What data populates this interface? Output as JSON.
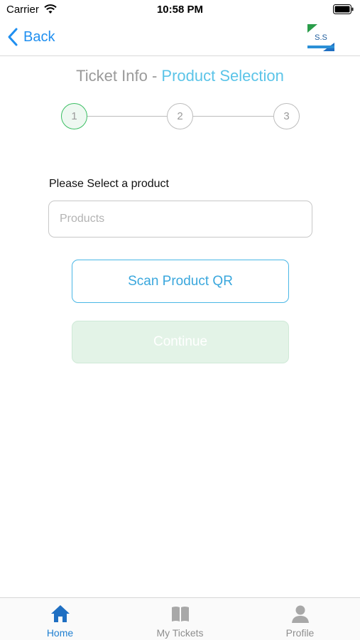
{
  "status_bar": {
    "carrier": "Carrier",
    "time": "10:58 PM"
  },
  "nav": {
    "back_label": "Back",
    "logo_text": "S.S"
  },
  "title": {
    "main": "Ticket Info",
    "separator": " - ",
    "sub": "Product Selection"
  },
  "stepper": {
    "steps": [
      "1",
      "2",
      "3"
    ],
    "active_step": "1"
  },
  "form": {
    "field_label": "Please Select a product",
    "products_placeholder": "Products",
    "scan_button": "Scan Product QR",
    "continue_button": "Continue"
  },
  "tab_bar": {
    "tabs": [
      {
        "label": "Home",
        "icon": "home-icon"
      },
      {
        "label": "My Tickets",
        "icon": "book-icon"
      },
      {
        "label": "Profile",
        "icon": "person-icon"
      }
    ],
    "active": "Home"
  },
  "colors": {
    "accent_blue": "#1f8ff0",
    "title_blue": "#5bc4e8",
    "active_step_green": "#3bbf63",
    "continue_disabled": "#e3f3e7"
  }
}
